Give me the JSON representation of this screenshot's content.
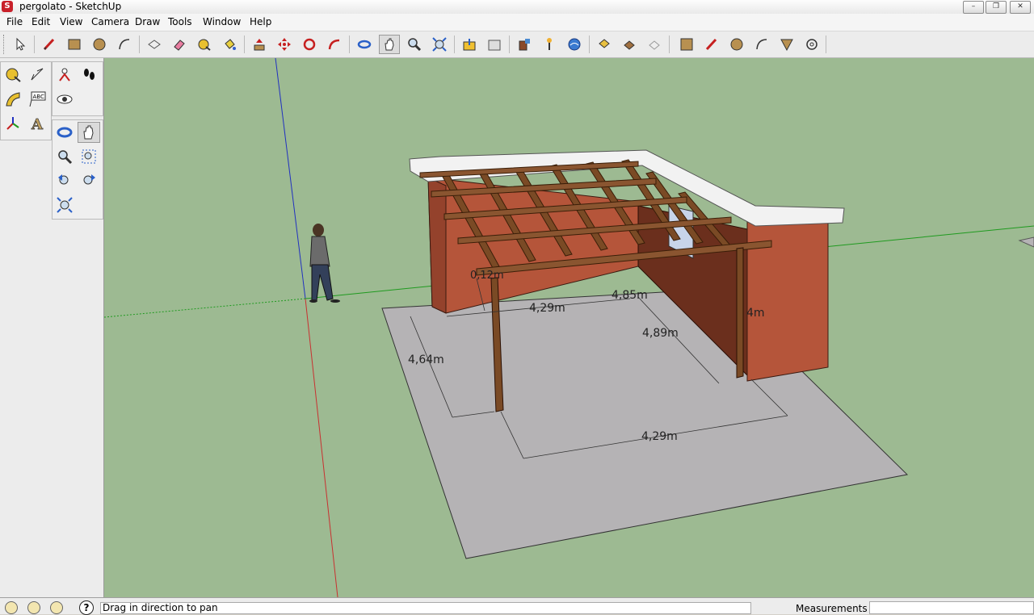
{
  "window": {
    "title": "pergolato - SketchUp",
    "app_icon_glyph": "S",
    "controls": {
      "minimize": "–",
      "maximize": "❐",
      "close": "✕"
    }
  },
  "menu": {
    "items": [
      {
        "label": "File"
      },
      {
        "label": "Edit"
      },
      {
        "label": "View"
      },
      {
        "label": "Camera"
      },
      {
        "label": "Draw"
      },
      {
        "label": "Tools"
      },
      {
        "label": "Window"
      },
      {
        "label": "Help"
      }
    ]
  },
  "toolbar": {
    "tools": [
      {
        "name": "select-tool"
      },
      {
        "name": "line-tool"
      },
      {
        "name": "rectangle-tool"
      },
      {
        "name": "circle-tool"
      },
      {
        "name": "arc-tool"
      },
      {
        "name": "make-component-tool"
      },
      {
        "name": "eraser-tool"
      },
      {
        "name": "tape-measure-tool"
      },
      {
        "name": "paint-bucket-tool"
      },
      {
        "name": "push-pull-tool"
      },
      {
        "name": "move-tool"
      },
      {
        "name": "rotate-tool"
      },
      {
        "name": "follow-me-tool"
      },
      {
        "name": "orbit-tool"
      },
      {
        "name": "pan-tool",
        "active": true
      },
      {
        "name": "zoom-tool"
      },
      {
        "name": "zoom-extents-tool"
      },
      {
        "name": "get-models-tool"
      },
      {
        "name": "share-model-tool"
      },
      {
        "name": "photo-textures-tool"
      },
      {
        "name": "add-location-tool"
      },
      {
        "name": "toggle-terrain-tool"
      },
      {
        "name": "get-current-view-tool"
      },
      {
        "name": "preview-model-tool"
      },
      {
        "name": "sandbox-from-contours-tool"
      },
      {
        "name": "face-tool"
      },
      {
        "name": "freehand-tool"
      },
      {
        "name": "polygon-tool"
      },
      {
        "name": "arc-2-tool"
      },
      {
        "name": "section-plane-tool"
      },
      {
        "name": "walk-look-tool"
      }
    ]
  },
  "sidebar": {
    "label_tool_text": "ABC",
    "text_tool_text": "A"
  },
  "canvas": {
    "dimensions": [
      {
        "label": "4,64m"
      },
      {
        "label": "4,29m"
      },
      {
        "label": "4,89m"
      },
      {
        "label": "4,29m"
      },
      {
        "label": "4,85m"
      },
      {
        "label": "0,12m"
      },
      {
        "label": "4m"
      }
    ]
  },
  "status": {
    "message": "Drag in direction to pan",
    "help_glyph": "?",
    "measurements_label": "Measurements",
    "measurements_value": ""
  },
  "colors": {
    "background_green": "#9dba92",
    "wall_red": "#b5553a",
    "timber_brown": "#7a4a25",
    "ground_grey": "#b5b3b5",
    "axis_red": "#c83030",
    "axis_green": "#1f9a1f",
    "axis_blue": "#2030c0"
  }
}
